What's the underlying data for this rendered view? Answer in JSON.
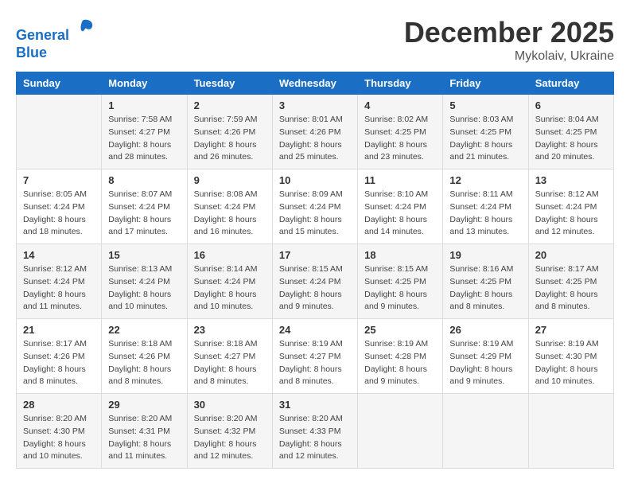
{
  "logo": {
    "line1": "General",
    "line2": "Blue"
  },
  "title": "December 2025",
  "subtitle": "Mykolaiv, Ukraine",
  "days_of_week": [
    "Sunday",
    "Monday",
    "Tuesday",
    "Wednesday",
    "Thursday",
    "Friday",
    "Saturday"
  ],
  "weeks": [
    [
      {
        "day": "",
        "sunrise": "",
        "sunset": "",
        "daylight": ""
      },
      {
        "day": "1",
        "sunrise": "Sunrise: 7:58 AM",
        "sunset": "Sunset: 4:27 PM",
        "daylight": "Daylight: 8 hours and 28 minutes."
      },
      {
        "day": "2",
        "sunrise": "Sunrise: 7:59 AM",
        "sunset": "Sunset: 4:26 PM",
        "daylight": "Daylight: 8 hours and 26 minutes."
      },
      {
        "day": "3",
        "sunrise": "Sunrise: 8:01 AM",
        "sunset": "Sunset: 4:26 PM",
        "daylight": "Daylight: 8 hours and 25 minutes."
      },
      {
        "day": "4",
        "sunrise": "Sunrise: 8:02 AM",
        "sunset": "Sunset: 4:25 PM",
        "daylight": "Daylight: 8 hours and 23 minutes."
      },
      {
        "day": "5",
        "sunrise": "Sunrise: 8:03 AM",
        "sunset": "Sunset: 4:25 PM",
        "daylight": "Daylight: 8 hours and 21 minutes."
      },
      {
        "day": "6",
        "sunrise": "Sunrise: 8:04 AM",
        "sunset": "Sunset: 4:25 PM",
        "daylight": "Daylight: 8 hours and 20 minutes."
      }
    ],
    [
      {
        "day": "7",
        "sunrise": "Sunrise: 8:05 AM",
        "sunset": "Sunset: 4:24 PM",
        "daylight": "Daylight: 8 hours and 18 minutes."
      },
      {
        "day": "8",
        "sunrise": "Sunrise: 8:07 AM",
        "sunset": "Sunset: 4:24 PM",
        "daylight": "Daylight: 8 hours and 17 minutes."
      },
      {
        "day": "9",
        "sunrise": "Sunrise: 8:08 AM",
        "sunset": "Sunset: 4:24 PM",
        "daylight": "Daylight: 8 hours and 16 minutes."
      },
      {
        "day": "10",
        "sunrise": "Sunrise: 8:09 AM",
        "sunset": "Sunset: 4:24 PM",
        "daylight": "Daylight: 8 hours and 15 minutes."
      },
      {
        "day": "11",
        "sunrise": "Sunrise: 8:10 AM",
        "sunset": "Sunset: 4:24 PM",
        "daylight": "Daylight: 8 hours and 14 minutes."
      },
      {
        "day": "12",
        "sunrise": "Sunrise: 8:11 AM",
        "sunset": "Sunset: 4:24 PM",
        "daylight": "Daylight: 8 hours and 13 minutes."
      },
      {
        "day": "13",
        "sunrise": "Sunrise: 8:12 AM",
        "sunset": "Sunset: 4:24 PM",
        "daylight": "Daylight: 8 hours and 12 minutes."
      }
    ],
    [
      {
        "day": "14",
        "sunrise": "Sunrise: 8:12 AM",
        "sunset": "Sunset: 4:24 PM",
        "daylight": "Daylight: 8 hours and 11 minutes."
      },
      {
        "day": "15",
        "sunrise": "Sunrise: 8:13 AM",
        "sunset": "Sunset: 4:24 PM",
        "daylight": "Daylight: 8 hours and 10 minutes."
      },
      {
        "day": "16",
        "sunrise": "Sunrise: 8:14 AM",
        "sunset": "Sunset: 4:24 PM",
        "daylight": "Daylight: 8 hours and 10 minutes."
      },
      {
        "day": "17",
        "sunrise": "Sunrise: 8:15 AM",
        "sunset": "Sunset: 4:24 PM",
        "daylight": "Daylight: 8 hours and 9 minutes."
      },
      {
        "day": "18",
        "sunrise": "Sunrise: 8:15 AM",
        "sunset": "Sunset: 4:25 PM",
        "daylight": "Daylight: 8 hours and 9 minutes."
      },
      {
        "day": "19",
        "sunrise": "Sunrise: 8:16 AM",
        "sunset": "Sunset: 4:25 PM",
        "daylight": "Daylight: 8 hours and 8 minutes."
      },
      {
        "day": "20",
        "sunrise": "Sunrise: 8:17 AM",
        "sunset": "Sunset: 4:25 PM",
        "daylight": "Daylight: 8 hours and 8 minutes."
      }
    ],
    [
      {
        "day": "21",
        "sunrise": "Sunrise: 8:17 AM",
        "sunset": "Sunset: 4:26 PM",
        "daylight": "Daylight: 8 hours and 8 minutes."
      },
      {
        "day": "22",
        "sunrise": "Sunrise: 8:18 AM",
        "sunset": "Sunset: 4:26 PM",
        "daylight": "Daylight: 8 hours and 8 minutes."
      },
      {
        "day": "23",
        "sunrise": "Sunrise: 8:18 AM",
        "sunset": "Sunset: 4:27 PM",
        "daylight": "Daylight: 8 hours and 8 minutes."
      },
      {
        "day": "24",
        "sunrise": "Sunrise: 8:19 AM",
        "sunset": "Sunset: 4:27 PM",
        "daylight": "Daylight: 8 hours and 8 minutes."
      },
      {
        "day": "25",
        "sunrise": "Sunrise: 8:19 AM",
        "sunset": "Sunset: 4:28 PM",
        "daylight": "Daylight: 8 hours and 9 minutes."
      },
      {
        "day": "26",
        "sunrise": "Sunrise: 8:19 AM",
        "sunset": "Sunset: 4:29 PM",
        "daylight": "Daylight: 8 hours and 9 minutes."
      },
      {
        "day": "27",
        "sunrise": "Sunrise: 8:19 AM",
        "sunset": "Sunset: 4:30 PM",
        "daylight": "Daylight: 8 hours and 10 minutes."
      }
    ],
    [
      {
        "day": "28",
        "sunrise": "Sunrise: 8:20 AM",
        "sunset": "Sunset: 4:30 PM",
        "daylight": "Daylight: 8 hours and 10 minutes."
      },
      {
        "day": "29",
        "sunrise": "Sunrise: 8:20 AM",
        "sunset": "Sunset: 4:31 PM",
        "daylight": "Daylight: 8 hours and 11 minutes."
      },
      {
        "day": "30",
        "sunrise": "Sunrise: 8:20 AM",
        "sunset": "Sunset: 4:32 PM",
        "daylight": "Daylight: 8 hours and 12 minutes."
      },
      {
        "day": "31",
        "sunrise": "Sunrise: 8:20 AM",
        "sunset": "Sunset: 4:33 PM",
        "daylight": "Daylight: 8 hours and 12 minutes."
      },
      {
        "day": "",
        "sunrise": "",
        "sunset": "",
        "daylight": ""
      },
      {
        "day": "",
        "sunrise": "",
        "sunset": "",
        "daylight": ""
      },
      {
        "day": "",
        "sunrise": "",
        "sunset": "",
        "daylight": ""
      }
    ]
  ]
}
